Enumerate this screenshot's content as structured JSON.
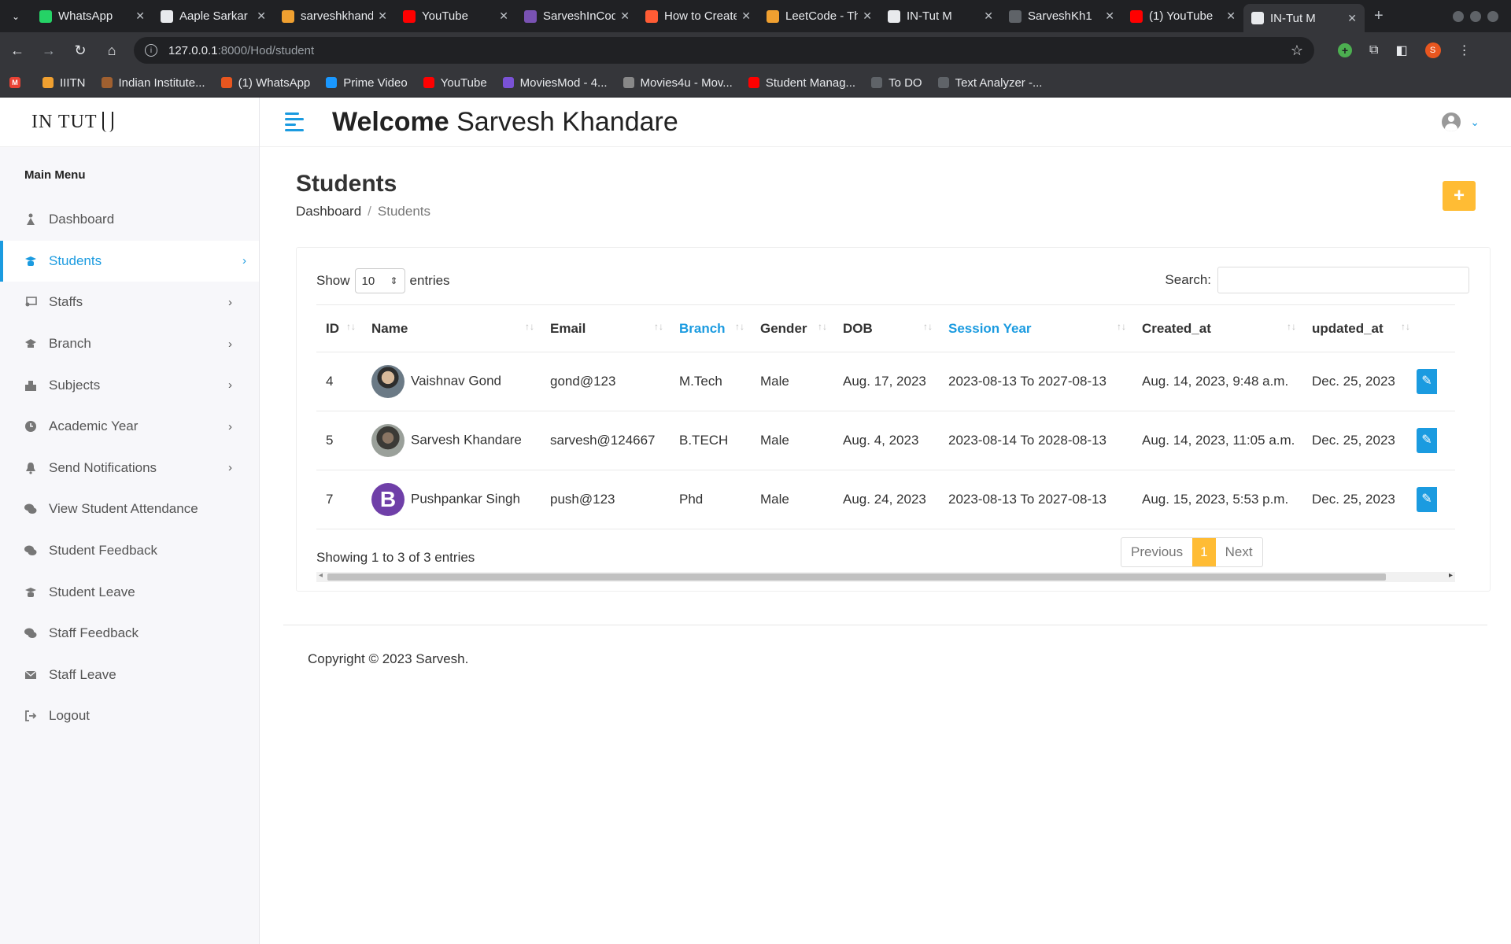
{
  "browser": {
    "tabs": [
      {
        "title": "WhatsApp",
        "icon": "whatsapp-icon",
        "color": "#25d366"
      },
      {
        "title": "Aaple Sarkar",
        "icon": "doc-icon",
        "color": "#e8eaed"
      },
      {
        "title": "sarveshkhandare",
        "icon": "code-icon",
        "color": "#f0a030"
      },
      {
        "title": "YouTube",
        "icon": "youtube-icon",
        "color": "#ff0000"
      },
      {
        "title": "SarveshInCode",
        "icon": "bootstrap-icon",
        "color": "#7952b3"
      },
      {
        "title": "How to Create",
        "icon": "hubspot-icon",
        "color": "#ff5c35"
      },
      {
        "title": "LeetCode - The",
        "icon": "leetcode-icon",
        "color": "#f0a030"
      },
      {
        "title": "IN-Tut M",
        "icon": "intut-icon",
        "color": "#e8eaed"
      },
      {
        "title": "SarveshKh1",
        "icon": "github-icon",
        "color": "#5f6368"
      },
      {
        "title": "(1) YouTube",
        "icon": "youtube-icon",
        "color": "#ff0000"
      },
      {
        "title": "IN-Tut M",
        "icon": "intut-icon",
        "color": "#e8eaed",
        "active": true
      }
    ],
    "url_host": "127.0.0.1",
    "url_path": ":8000/Hod/student",
    "profile_initial": "S",
    "bookmarks": [
      {
        "label": "IIITN",
        "icon": "iiitn-icon",
        "color": "#f0a030"
      },
      {
        "label": "Indian Institute...",
        "icon": "institute-icon",
        "color": "#a06030"
      },
      {
        "label": "(1) WhatsApp",
        "icon": "whatsapp-icon",
        "color": "#e8561f"
      },
      {
        "label": "Prime Video",
        "icon": "prime-icon",
        "color": "#1a98ff"
      },
      {
        "label": "YouTube",
        "icon": "youtube-icon",
        "color": "#ff0000"
      },
      {
        "label": "MoviesMod - 4...",
        "icon": "movies-icon",
        "color": "#7a52d6"
      },
      {
        "label": "Movies4u - Mov...",
        "icon": "movies-icon",
        "color": "#888888"
      },
      {
        "label": "Student Manag...",
        "icon": "youtube-icon",
        "color": "#ff0000"
      },
      {
        "label": "To DO",
        "icon": "globe-icon",
        "color": "#5f6368"
      },
      {
        "label": "Text Analyzer -...",
        "icon": "gear-icon",
        "color": "#5f6368"
      }
    ]
  },
  "app": {
    "logo": "IN TUT",
    "welcome_bold": "Welcome",
    "welcome_name": "Sarvesh Khandare",
    "menu_title": "Main Menu",
    "menu": [
      {
        "label": "Dashboard",
        "icon": "dashboard-icon",
        "active": false,
        "chevron": false
      },
      {
        "label": "Students",
        "icon": "students-icon",
        "active": true,
        "chevron": true
      },
      {
        "label": "Staffs",
        "icon": "staff-icon",
        "active": false,
        "chevron": true
      },
      {
        "label": "Branch",
        "icon": "branch-icon",
        "active": false,
        "chevron": true
      },
      {
        "label": "Subjects",
        "icon": "subjects-icon",
        "active": false,
        "chevron": true
      },
      {
        "label": "Academic Year",
        "icon": "clock-icon",
        "active": false,
        "chevron": true
      },
      {
        "label": "Send Notifications",
        "icon": "bell-icon",
        "active": false,
        "chevron": true
      },
      {
        "label": "View Student Attendance",
        "icon": "chat-icon",
        "active": false,
        "chevron": false
      },
      {
        "label": "Student Feedback",
        "icon": "chat-icon",
        "active": false,
        "chevron": false
      },
      {
        "label": "Student Leave",
        "icon": "leave-icon",
        "active": false,
        "chevron": false
      },
      {
        "label": "Staff Feedback",
        "icon": "chat-icon",
        "active": false,
        "chevron": false
      },
      {
        "label": "Staff Leave",
        "icon": "mail-icon",
        "active": false,
        "chevron": false
      },
      {
        "label": "Logout",
        "icon": "logout-icon",
        "active": false,
        "chevron": false
      }
    ],
    "page_title": "Students",
    "breadcrumb": {
      "home": "Dashboard",
      "current": "Students"
    },
    "add_label": "+",
    "table": {
      "show_label": "Show",
      "entries_value": "10",
      "entries_label": "entries",
      "search_label": "Search:",
      "columns": [
        {
          "label": "ID",
          "highlight": false
        },
        {
          "label": "Name",
          "highlight": false
        },
        {
          "label": "Email",
          "highlight": false
        },
        {
          "label": "Branch",
          "highlight": true
        },
        {
          "label": "Gender",
          "highlight": false
        },
        {
          "label": "DOB",
          "highlight": false
        },
        {
          "label": "Session Year",
          "highlight": true
        },
        {
          "label": "Created_at",
          "highlight": false
        },
        {
          "label": "updated_at",
          "highlight": false
        }
      ],
      "rows": [
        {
          "id": "4",
          "name": "Vaishnav Gond",
          "avatar": "photo",
          "email": "gond@123",
          "branch": "M.Tech",
          "gender": "Male",
          "dob": "Aug. 17, 2023",
          "session": "2023-08-13 To 2027-08-13",
          "created": "Aug. 14, 2023, 9:48 a.m.",
          "updated": "Dec. 25, 2023"
        },
        {
          "id": "5",
          "name": "Sarvesh Khandare",
          "avatar": "photo",
          "email": "sarvesh@124667",
          "branch": "B.TECH",
          "gender": "Male",
          "dob": "Aug. 4, 2023",
          "session": "2023-08-14 To 2028-08-13",
          "created": "Aug. 14, 2023, 11:05 a.m.",
          "updated": "Dec. 25, 2023"
        },
        {
          "id": "7",
          "name": "Pushpankar Singh",
          "avatar": "B",
          "email": "push@123",
          "branch": "Phd",
          "gender": "Male",
          "dob": "Aug. 24, 2023",
          "session": "2023-08-13 To 2027-08-13",
          "created": "Aug. 15, 2023, 5:53 p.m.",
          "updated": "Dec. 25, 2023"
        }
      ],
      "showing_text": "Showing 1 to 3 of 3 entries",
      "pager": {
        "prev": "Previous",
        "current": "1",
        "next": "Next"
      }
    },
    "footer": "Copyright © 2023 Sarvesh.",
    "colors": {
      "accent": "#1b9be0",
      "warning": "#ffbc34"
    }
  }
}
